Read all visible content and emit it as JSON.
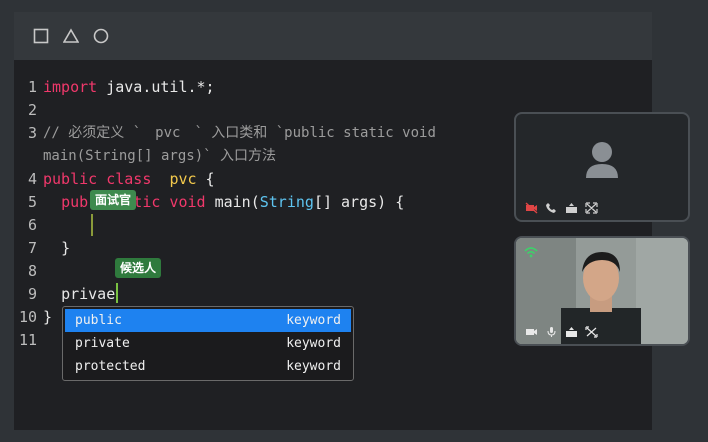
{
  "toolbar": {
    "icons": [
      "square-icon",
      "triangle-icon",
      "circle-icon"
    ]
  },
  "code": {
    "line_numbers": [
      "1",
      "2",
      "3",
      "",
      "4",
      "5",
      "6",
      "7",
      "8",
      "9",
      "10",
      "11"
    ],
    "l1_kw": "import",
    "l1_rest": " java.util.*;",
    "l3_a": "// 必须定义 `",
    "l3_pvc": "pvc",
    "l3_b": "` 入口类和 `public static void",
    "l3_c": "main(String[] args)` 入口方法",
    "l4_kw": "public class",
    "l4_pvc": "pvc",
    "l4_rest": " {",
    "l5_a": "pub",
    "l5_kw": "atic void",
    "l5_b": " main(",
    "l5_ty": "String",
    "l5_c": "[] args) {",
    "l7": "}",
    "l9": "privae",
    "l10": "}"
  },
  "labels": {
    "interviewer": "面试官",
    "candidate": "候选人"
  },
  "autocomplete": [
    {
      "label": "public",
      "kind": "keyword"
    },
    {
      "label": "private",
      "kind": "keyword"
    },
    {
      "label": "protected",
      "kind": "keyword"
    }
  ],
  "colors": {
    "keyword": "#f0386b",
    "type": "#5ec4f0",
    "class_name": "#f2c94c",
    "selection": "#1e82f0",
    "tag": "#3e8a4e"
  }
}
